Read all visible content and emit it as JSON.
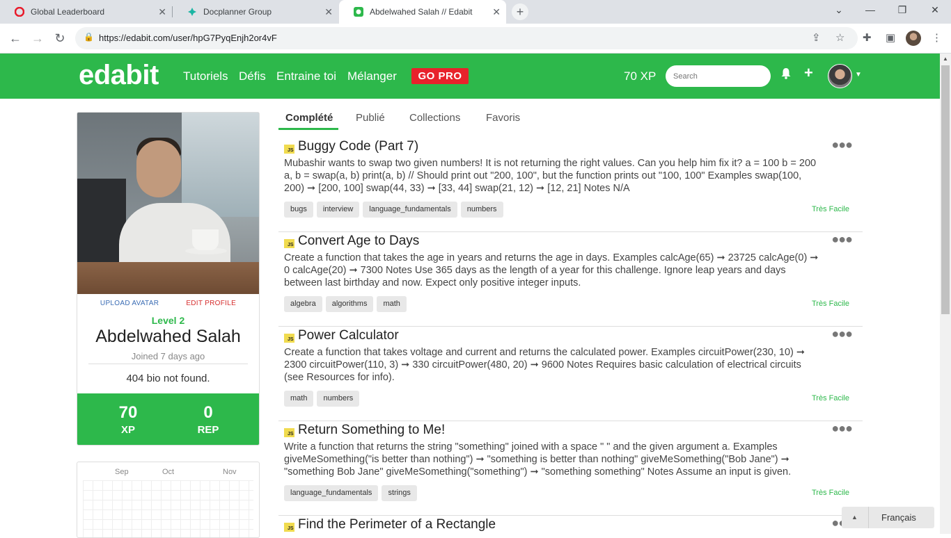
{
  "browser": {
    "tabs": [
      {
        "title": "Global Leaderboard",
        "icon": "opera-icon"
      },
      {
        "title": "Docplanner Group",
        "icon": "docplanner-icon"
      },
      {
        "title": "Abdelwahed Salah // Edabit",
        "icon": "edabit-icon"
      }
    ],
    "url": "https://edabit.com/user/hpG7PyqEnjh2or4vF"
  },
  "header": {
    "logo": "edabit",
    "nav": [
      "Tutoriels",
      "Défis",
      "Entraine toi",
      "Mélanger"
    ],
    "gopro": "GO PRO",
    "xp": "70 XP",
    "search_placeholder": "Search",
    "color": "#2db84b"
  },
  "profile": {
    "upload_avatar": "UPLOAD AVATAR",
    "edit_profile": "EDIT PROFILE",
    "level": "Level 2",
    "name": "Abdelwahed Salah",
    "joined": "Joined 7 days ago",
    "bio": "404 bio not found.",
    "xp_value": "70",
    "xp_label": "XP",
    "rep_value": "0",
    "rep_label": "REP"
  },
  "calendar": {
    "months": [
      "Sep",
      "Oct",
      "Nov"
    ]
  },
  "content_tabs": [
    "Complété",
    "Publié",
    "Collections",
    "Favoris"
  ],
  "challenges": [
    {
      "lang": "JS",
      "title": "Buggy Code (Part 7)",
      "description": "Mubashir wants to swap two given numbers! It is not returning the right values. Can you help him fix it? a = 100 b = 200 a, b = swap(a, b) print(a, b) // Should print out \"200, 100\", but the function prints out \"100, 100\" Examples swap(100, 200) ➞ [200, 100] swap(44, 33) ➞ [33, 44] swap(21, 12) ➞ [12, 21] Notes N/A",
      "tags": [
        "bugs",
        "interview",
        "language_fundamentals",
        "numbers"
      ],
      "difficulty": "Très Facile"
    },
    {
      "lang": "JS",
      "title": "Convert Age to Days",
      "description": "Create a function that takes the age in years and returns the age in days. Examples calcAge(65) ➞ 23725 calcAge(0) ➞ 0 calcAge(20) ➞ 7300 Notes Use 365 days as the length of a year for this challenge. Ignore leap years and days between last birthday and now. Expect only positive integer inputs.",
      "tags": [
        "algebra",
        "algorithms",
        "math"
      ],
      "difficulty": "Très Facile"
    },
    {
      "lang": "JS",
      "title": "Power Calculator",
      "description": "Create a function that takes voltage and current and returns the calculated power. Examples circuitPower(230, 10) ➞ 2300 circuitPower(110, 3) ➞ 330 circuitPower(480, 20) ➞ 9600 Notes Requires basic calculation of electrical circuits (see Resources for info).",
      "tags": [
        "math",
        "numbers"
      ],
      "difficulty": "Très Facile"
    },
    {
      "lang": "JS",
      "title": "Return Something to Me!",
      "description": "Write a function that returns the string \"something\" joined with a space \" \" and the given argument a. Examples giveMeSomething(\"is better than nothing\") ➞ \"something is better than nothing\" giveMeSomething(\"Bob Jane\") ➞ \"something Bob Jane\" giveMeSomething(\"something\") ➞ \"something something\" Notes Assume an input is given.",
      "tags": [
        "language_fundamentals",
        "strings"
      ],
      "difficulty": "Très Facile"
    },
    {
      "lang": "JS",
      "title": "Find the Perimeter of a Rectangle",
      "description": "",
      "tags": [],
      "difficulty": ""
    }
  ],
  "language": "Français"
}
